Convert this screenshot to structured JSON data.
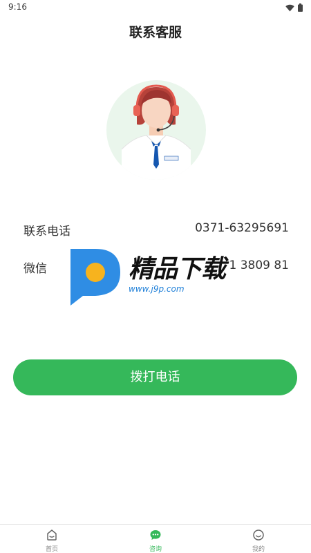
{
  "status_bar": {
    "time": "9:16"
  },
  "header": {
    "title": "联系客服"
  },
  "contact": {
    "phone_label": "联系电话",
    "phone_value": "0371-63295691",
    "wechat_label": "微信",
    "wechat_value": "1 3809 81"
  },
  "watermark": {
    "brand": "精品下载",
    "url": "www.j9p.com"
  },
  "actions": {
    "call_label": "拨打电话"
  },
  "tabs": [
    {
      "label": "首页",
      "icon": "home-icon",
      "active": false
    },
    {
      "label": "咨询",
      "icon": "chat-icon",
      "active": true
    },
    {
      "label": "我的",
      "icon": "smile-icon",
      "active": false
    }
  ],
  "colors": {
    "accent": "#35b85a",
    "avatar_bg": "#eaf6ec",
    "watermark_blue": "#1e7fd8"
  }
}
